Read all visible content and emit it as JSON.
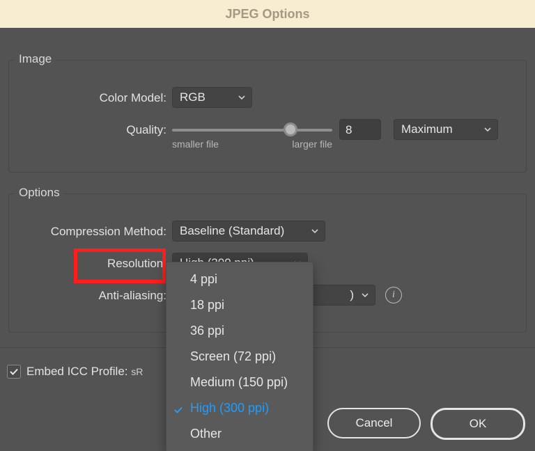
{
  "title": "JPEG Options",
  "image_group": {
    "title": "Image",
    "color_model_label": "Color Model:",
    "color_model_value": "RGB",
    "quality_label": "Quality:",
    "quality_value": "8",
    "quality_preset": "Maximum",
    "quality_caption_min": "smaller file",
    "quality_caption_max": "larger file",
    "quality_slider_percent": 74
  },
  "options_group": {
    "title": "Options",
    "compression_label": "Compression Method:",
    "compression_value": "Baseline (Standard)",
    "resolution_label": "Resolution:",
    "resolution_value": "High (300 ppi)",
    "resolution_options": [
      "4 ppi",
      "18 ppi",
      "36 ppi",
      "Screen (72 ppi)",
      "Medium (150 ppi)",
      "High (300 ppi)",
      "Other"
    ],
    "resolution_selected_index": 5,
    "anti_alias_label": "Anti-aliasing:",
    "anti_alias_visible_fragment": ")"
  },
  "embed": {
    "label_prefix": "Embed ICC Profile:",
    "profile_visible_fragment": "sR",
    "checked": true
  },
  "buttons": {
    "cancel": "Cancel",
    "ok": "OK"
  }
}
